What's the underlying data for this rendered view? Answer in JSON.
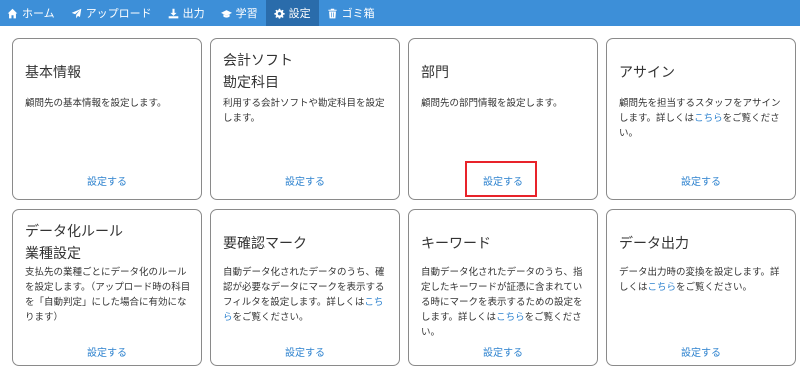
{
  "nav": {
    "items": [
      {
        "label": "ホーム",
        "icon": "home-icon"
      },
      {
        "label": "アップロード",
        "icon": "paper-plane-icon"
      },
      {
        "label": "出力",
        "icon": "download-icon"
      },
      {
        "label": "学習",
        "icon": "graduation-cap-icon"
      },
      {
        "label": "設定",
        "icon": "gear-icon",
        "active": true
      },
      {
        "label": "ゴミ箱",
        "icon": "trash-icon"
      }
    ]
  },
  "cards": [
    {
      "title": "基本情報",
      "desc": "顧問先の基本情報を設定します。",
      "setting_label": "設定する"
    },
    {
      "title": "会計ソフト\n勘定科目",
      "desc": "利用する会計ソフトや勘定科目を設定します。",
      "setting_label": "設定する"
    },
    {
      "title": "部門",
      "desc": "顧問先の部門情報を設定します。",
      "setting_label": "設定する"
    },
    {
      "title": "アサイン",
      "desc_before": "顧問先を担当するスタッフをアサインします。詳しくは",
      "desc_link": "こちら",
      "desc_after": "をご覧ください。",
      "setting_label": "設定する"
    },
    {
      "title": "データ化ルール\n業種設定",
      "desc": "支払先の業種ごとにデータ化のルールを設定します。（アップロード時の科目を「自動判定」にした場合に有効になります）",
      "setting_label": "設定する"
    },
    {
      "title": "要確認マーク",
      "desc_before": "自動データ化されたデータのうち、確認が必要なデータにマークを表示するフィルタを設定します。詳しくは",
      "desc_link": "こちら",
      "desc_after": "をご覧ください。",
      "setting_label": "設定する"
    },
    {
      "title": "キーワード",
      "desc_before": "自動データ化されたデータのうち、指定したキーワードが証憑に含まれている時にマークを表示するための設定をします。詳しくは",
      "desc_link": "こちら",
      "desc_after": "をご覧ください。",
      "setting_label": "設定する"
    },
    {
      "title": "データ出力",
      "desc_before": "データ出力時の変換を設定します。詳しくは",
      "desc_link": "こちら",
      "desc_after": "をご覧ください。",
      "setting_label": "設定する"
    }
  ],
  "colors": {
    "navbar": "#3d8fd8",
    "navbar_active": "#2a6cab",
    "link": "#2f83cf",
    "highlight": "#e8232a",
    "card_border": "#8a8a8a"
  }
}
